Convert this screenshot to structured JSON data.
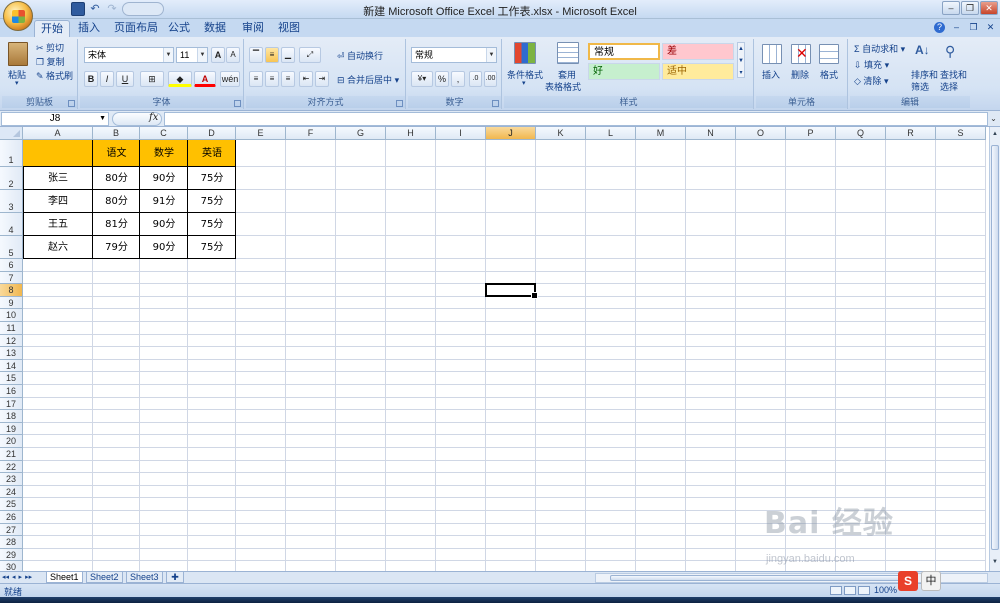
{
  "window": {
    "title": "新建 Microsoft Office Excel 工作表.xlsx - Microsoft Excel"
  },
  "window_controls": {
    "minimize": "–",
    "restore": "❐",
    "close": "✕"
  },
  "ribbon_tabs": [
    "开始",
    "插入",
    "页面布局",
    "公式",
    "数据",
    "审阅",
    "视图"
  ],
  "active_tab": "开始",
  "ribbon": {
    "clipboard": {
      "group": "剪贴板",
      "paste": "粘贴",
      "cut": "剪切",
      "copy": "复制",
      "format_painter": "格式刷"
    },
    "font": {
      "group": "字体",
      "font_name": "宋体",
      "font_size": "11",
      "bold": "B",
      "italic": "I",
      "underline": "U",
      "grow": "A",
      "shrink": "A",
      "font_color": "A",
      "phonetic": "wén"
    },
    "alignment": {
      "group": "对齐方式",
      "wrap": "自动换行",
      "merge": "合并后居中"
    },
    "number": {
      "group": "数字",
      "format": "常规",
      "percent": "%",
      "comma": ","
    },
    "styles": {
      "group": "样式",
      "conditional": "条件格式",
      "table_format_1": "套用",
      "table_format_2": "表格格式",
      "normal": "常规",
      "bad": "差",
      "good": "好",
      "neutral": "适中"
    },
    "cells": {
      "group": "单元格",
      "insert": "插入",
      "delete": "删除",
      "format": "格式"
    },
    "editing": {
      "group": "编辑",
      "autosum": "自动求和",
      "fill": "填充",
      "clear": "清除",
      "sort_1": "排序和",
      "sort_2": "筛选",
      "find_1": "查找和",
      "find_2": "选择"
    }
  },
  "formula_bar": {
    "name_box": "J8",
    "fx": "fx",
    "formula": ""
  },
  "columns": [
    "A",
    "B",
    "C",
    "D",
    "E",
    "F",
    "G",
    "H",
    "I",
    "J",
    "K",
    "L",
    "M",
    "N",
    "O",
    "P",
    "Q",
    "R",
    "S"
  ],
  "rows": [
    "1",
    "2",
    "3",
    "4",
    "5",
    "6",
    "7",
    "8",
    "9",
    "10",
    "11",
    "12",
    "13",
    "14",
    "15",
    "16",
    "17",
    "18",
    "19",
    "20",
    "21",
    "22",
    "23",
    "24",
    "25",
    "26",
    "27",
    "28",
    "29",
    "30"
  ],
  "selected_cell": {
    "col": "J",
    "row": "8"
  },
  "table": {
    "header": [
      "",
      "语文",
      "数学",
      "英语"
    ],
    "rows": [
      [
        "张三",
        "80分",
        "90分",
        "75分"
      ],
      [
        "李四",
        "80分",
        "91分",
        "75分"
      ],
      [
        "王五",
        "81分",
        "90分",
        "75分"
      ],
      [
        "赵六",
        "79分",
        "90分",
        "75分"
      ]
    ],
    "header_fill": "#ffc000"
  },
  "sheets": [
    "Sheet1",
    "Sheet2",
    "Sheet3"
  ],
  "active_sheet": "Sheet1",
  "status": {
    "text": "就绪",
    "zoom": "100%"
  },
  "ime": {
    "sogou": "S",
    "mode": "中"
  },
  "watermark": {
    "main": "Bai 经验",
    "sub": "jingyan.baidu.com"
  }
}
